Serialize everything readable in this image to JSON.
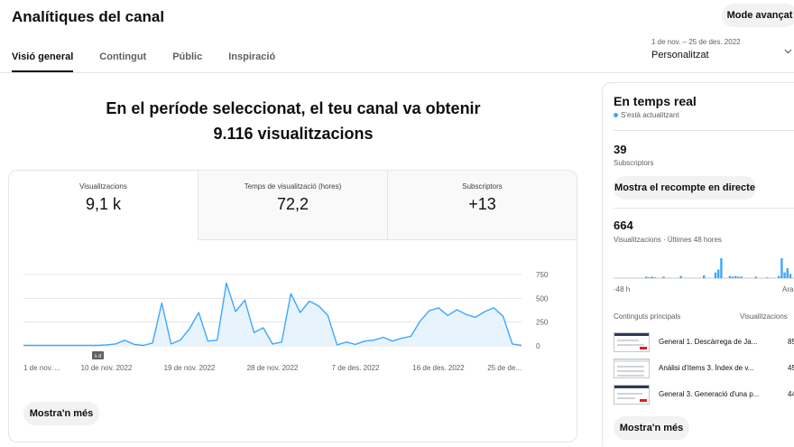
{
  "header": {
    "title": "Analítiques del canal",
    "advanced_mode": "Mode avançat"
  },
  "tabs": [
    {
      "label": "Visió general",
      "active": true
    },
    {
      "label": "Contingut",
      "active": false
    },
    {
      "label": "Públic",
      "active": false
    },
    {
      "label": "Inspiració",
      "active": false
    }
  ],
  "period": {
    "range": "1 de nov. – 25 de des. 2022",
    "label": "Personalitzat"
  },
  "headline": {
    "line1": "En el període seleccionat, el teu canal va obtenir",
    "line2": "9.116 visualitzacions"
  },
  "metrics": [
    {
      "label": "Visualitzacions",
      "value": "9,1 k"
    },
    {
      "label": "Temps de visualització (hores)",
      "value": "72,2"
    },
    {
      "label": "Subscriptors",
      "value": "+13"
    }
  ],
  "chart_data": {
    "type": "area",
    "title": "",
    "xlabel": "",
    "ylabel": "",
    "ylim": [
      0,
      750
    ],
    "yticks": [
      "750",
      "500",
      "250",
      "0"
    ],
    "xticks": [
      "1 de nov. ...",
      "10 de nov. 2022",
      "19 de nov. 2022",
      "28 de nov. 2022",
      "7 de des. 2022",
      "16 de des. 2022",
      "25 de de..."
    ],
    "x": [
      "2022-11-01",
      "2022-11-02",
      "2022-11-03",
      "2022-11-04",
      "2022-11-05",
      "2022-11-06",
      "2022-11-07",
      "2022-11-08",
      "2022-11-09",
      "2022-11-10",
      "2022-11-11",
      "2022-11-12",
      "2022-11-13",
      "2022-11-14",
      "2022-11-15",
      "2022-11-16",
      "2022-11-17",
      "2022-11-18",
      "2022-11-19",
      "2022-11-20",
      "2022-11-21",
      "2022-11-22",
      "2022-11-23",
      "2022-11-24",
      "2022-11-25",
      "2022-11-26",
      "2022-11-27",
      "2022-11-28",
      "2022-11-29",
      "2022-11-30",
      "2022-12-01",
      "2022-12-02",
      "2022-12-03",
      "2022-12-04",
      "2022-12-05",
      "2022-12-06",
      "2022-12-07",
      "2022-12-08",
      "2022-12-09",
      "2022-12-10",
      "2022-12-11",
      "2022-12-12",
      "2022-12-13",
      "2022-12-14",
      "2022-12-15",
      "2022-12-16",
      "2022-12-17",
      "2022-12-18",
      "2022-12-19",
      "2022-12-20",
      "2022-12-21",
      "2022-12-22",
      "2022-12-23",
      "2022-12-24",
      "2022-12-25"
    ],
    "values": [
      5,
      5,
      5,
      5,
      5,
      5,
      5,
      5,
      5,
      10,
      20,
      60,
      15,
      5,
      30,
      450,
      20,
      60,
      180,
      350,
      50,
      60,
      660,
      360,
      480,
      140,
      190,
      20,
      40,
      550,
      350,
      470,
      420,
      320,
      10,
      40,
      15,
      50,
      60,
      90,
      50,
      80,
      100,
      260,
      370,
      400,
      320,
      380,
      330,
      300,
      360,
      400,
      310,
      20,
      5
    ],
    "marker": "s d",
    "series_color": "#3ea6ff",
    "fill_color": "#e8f4fd"
  },
  "more_button": "Mostra'n més",
  "realtime": {
    "title": "En temps real",
    "status": "S'està actualitzant",
    "subscribers_value": "39",
    "subscribers_label": "Subscriptors",
    "live_count_button": "Mostra el recompte en directe",
    "views_value": "664",
    "views_label": "Visualitzacions · Últimes 48 hores",
    "bars": [
      0,
      0,
      0,
      0,
      0,
      0,
      0,
      0,
      0,
      0,
      0,
      2,
      1,
      2,
      1,
      0,
      0,
      2,
      0,
      0,
      0,
      0,
      0,
      3,
      0,
      0,
      0,
      0,
      0,
      0,
      0,
      4,
      0,
      0,
      0,
      8,
      12,
      28,
      0,
      0,
      3,
      2,
      3,
      2,
      2,
      0,
      0,
      0,
      0,
      2,
      0,
      0,
      0,
      1,
      0,
      0,
      0,
      3,
      28,
      8,
      14,
      6
    ],
    "axis_left": "-48 h",
    "axis_right": "Ara",
    "top_content_label": "Continguts principals",
    "top_content_views_label": "Visualitzacions",
    "top_content": [
      {
        "title": "General 1. Descàrrega de Ja...",
        "views": "85"
      },
      {
        "title": "Anàlisi d'ítems 3. Índex de v...",
        "views": "45"
      },
      {
        "title": "General 3. Generació d'una p...",
        "views": "44"
      }
    ],
    "more_button": "Mostra'n més"
  }
}
